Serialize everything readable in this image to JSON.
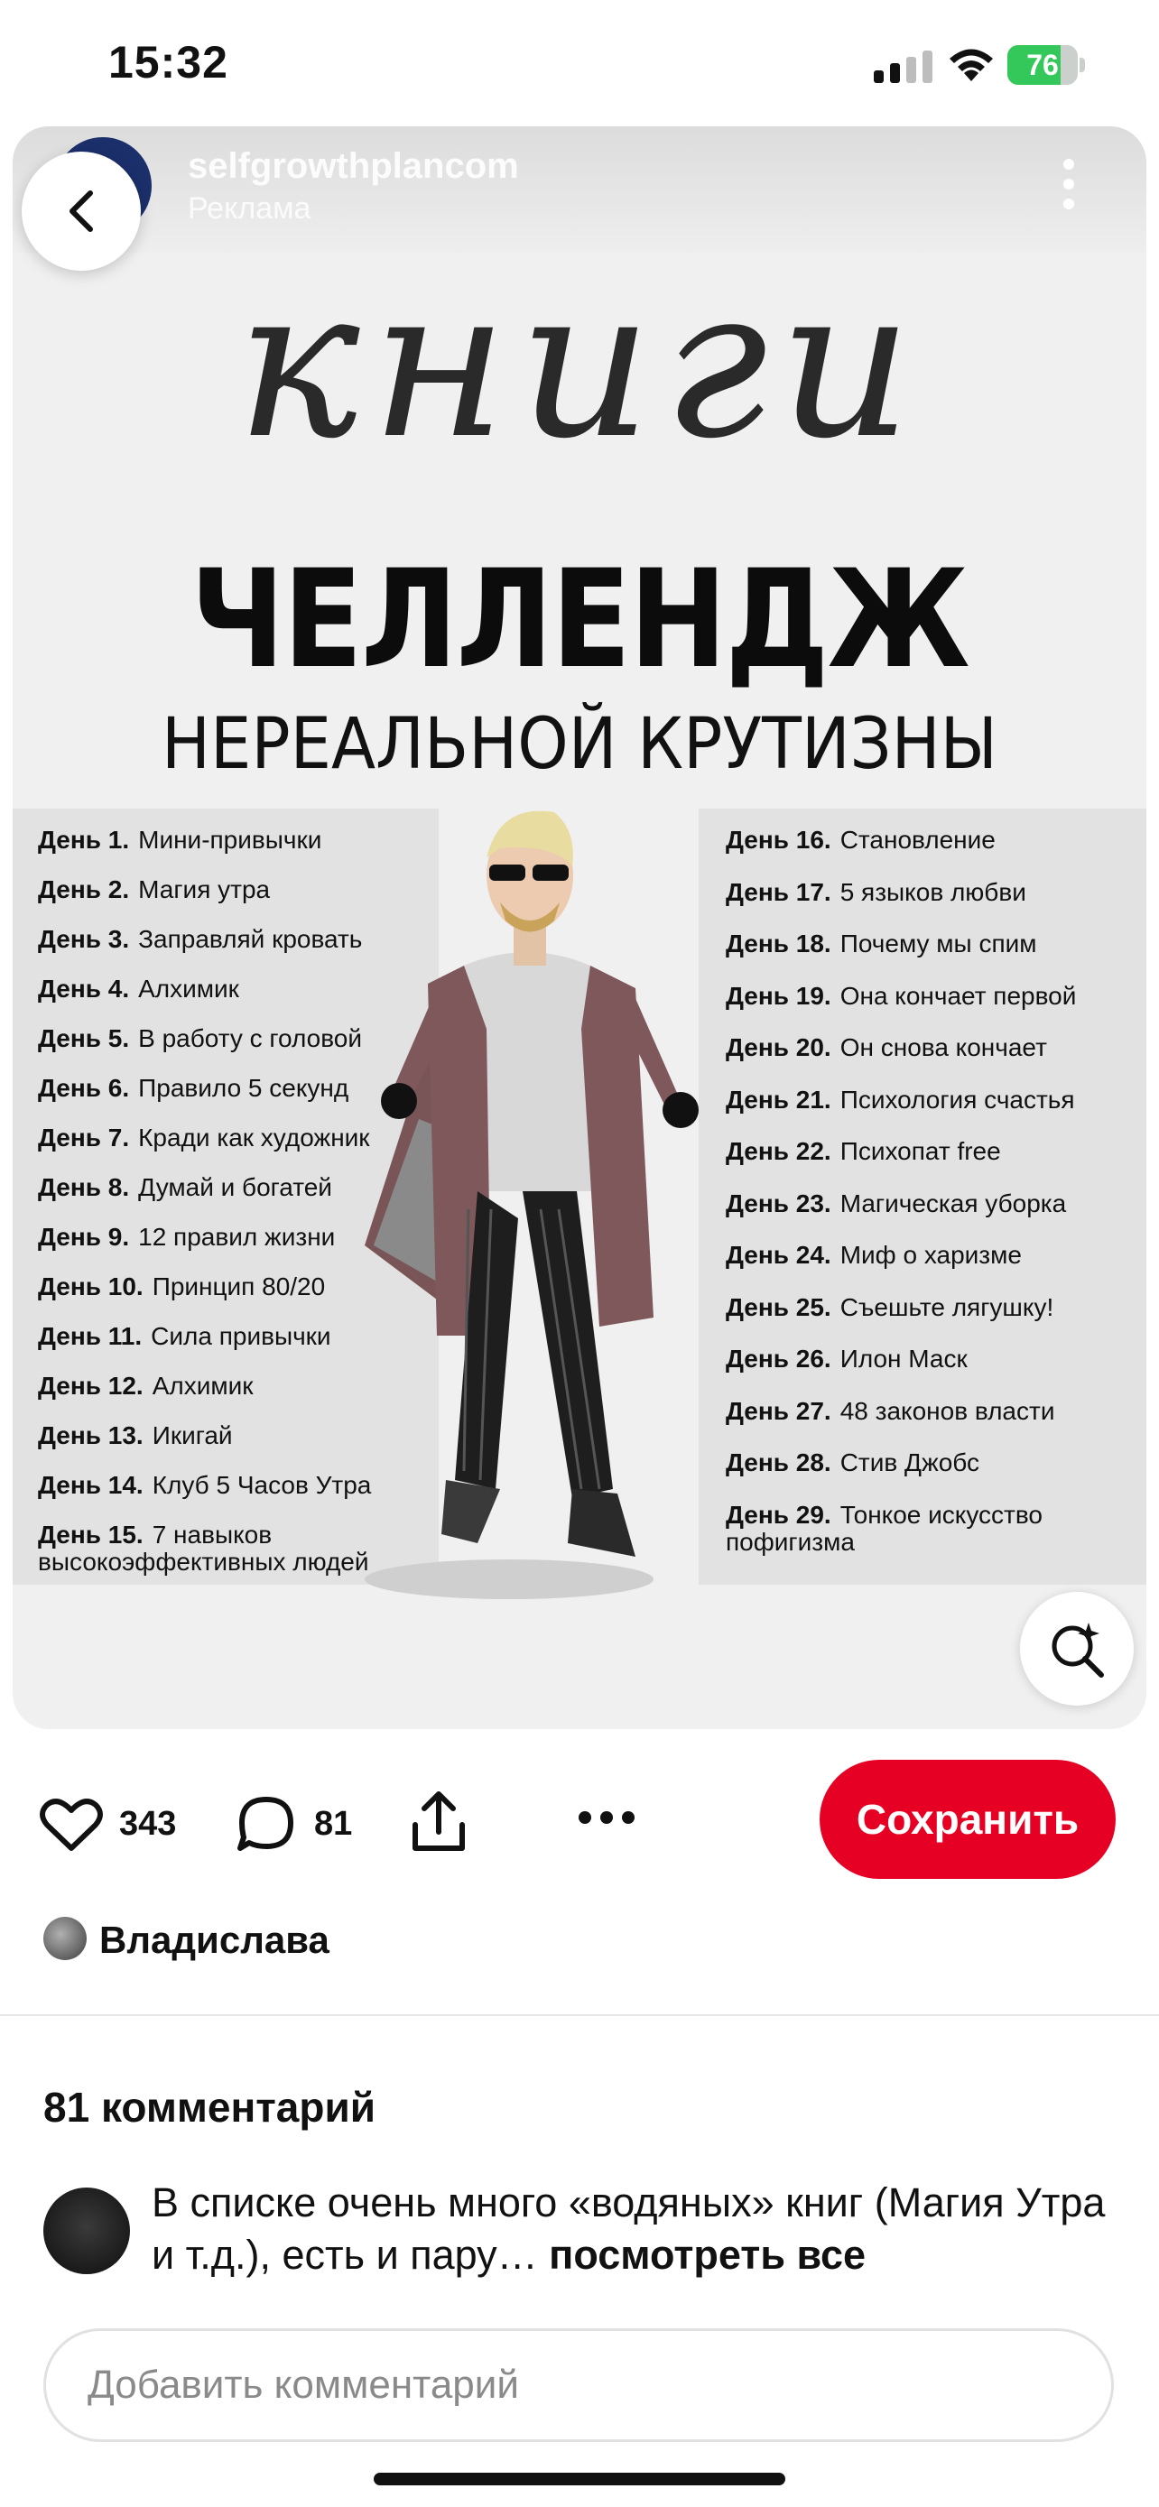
{
  "status_bar": {
    "time": "15:32",
    "battery": "76",
    "battery_level": 0.76
  },
  "pin": {
    "advertiser": "selfgrowthplancom",
    "ad_label": "Реклама",
    "script_title": "книги",
    "challenge_title": "ЧЕЛЛЕНДЖ",
    "challenge_subtitle": "НЕРЕАЛЬНОЙ КРУТИЗНЫ",
    "days_left": [
      {
        "day": "День 1.",
        "title": "Мини-привычки"
      },
      {
        "day": "День 2.",
        "title": "Магия утра"
      },
      {
        "day": "День 3.",
        "title": "Заправляй кровать"
      },
      {
        "day": "День 4.",
        "title": "Алхимик"
      },
      {
        "day": "День 5.",
        "title": "В работу с головой"
      },
      {
        "day": "День 6.",
        "title": "Правило 5 секунд"
      },
      {
        "day": "День 7.",
        "title": "Кради как художник"
      },
      {
        "day": "День 8.",
        "title": "Думай и богатей"
      },
      {
        "day": "День 9.",
        "title": "12 правил жизни"
      },
      {
        "day": "День 10.",
        "title": "Принцип 80/20"
      },
      {
        "day": "День 11.",
        "title": "Сила привычки"
      },
      {
        "day": "День 12.",
        "title": "Алхимик"
      },
      {
        "day": "День 13.",
        "title": "Икигай"
      },
      {
        "day": "День 14.",
        "title": "Клуб 5 Часов Утра"
      },
      {
        "day": "День 15.",
        "title": "7 навыков",
        "title2": "высокоэффективных людей"
      }
    ],
    "days_right": [
      {
        "day": "День 16.",
        "title": "Становление"
      },
      {
        "day": "День 17.",
        "title": "5 языков любви"
      },
      {
        "day": "День 18.",
        "title": "Почему мы спим"
      },
      {
        "day": "День 19.",
        "title": "Она кончает первой"
      },
      {
        "day": "День 20.",
        "title": "Он снова кончает"
      },
      {
        "day": "День 21.",
        "title": "Психология счастья"
      },
      {
        "day": "День 22.",
        "title": "Психопат free"
      },
      {
        "day": "День 23.",
        "title": "Магическая уборка"
      },
      {
        "day": "День 24.",
        "title": "Миф о харизме"
      },
      {
        "day": "День 25.",
        "title": "Съешьте лягушку!"
      },
      {
        "day": "День 26.",
        "title": "Илон Маск"
      },
      {
        "day": "День 27.",
        "title": "48 законов власти"
      },
      {
        "day": "День 28.",
        "title": "Стив Джобс"
      },
      {
        "day": "День 29.",
        "title": "Тонкое искусство",
        "title2": "пофигизма"
      }
    ]
  },
  "actions": {
    "likes": "343",
    "comments": "81",
    "save_label": "Сохранить"
  },
  "author": {
    "name": "Владислава"
  },
  "comments": {
    "heading": "81 комментарий",
    "first": {
      "text": "В списке очень много «водяных» книг (Магия Утра и т.д.), есть и пару… ",
      "see_all": "посмотреть все"
    },
    "input_placeholder": "Добавить комментарий"
  },
  "colors": {
    "save_button": "#e60023",
    "battery": "#34c759"
  },
  "icons": [
    "back-icon",
    "more-vert-icon",
    "visual-search-icon",
    "heart-icon",
    "comment-icon",
    "share-icon",
    "more-horiz-icon"
  ]
}
